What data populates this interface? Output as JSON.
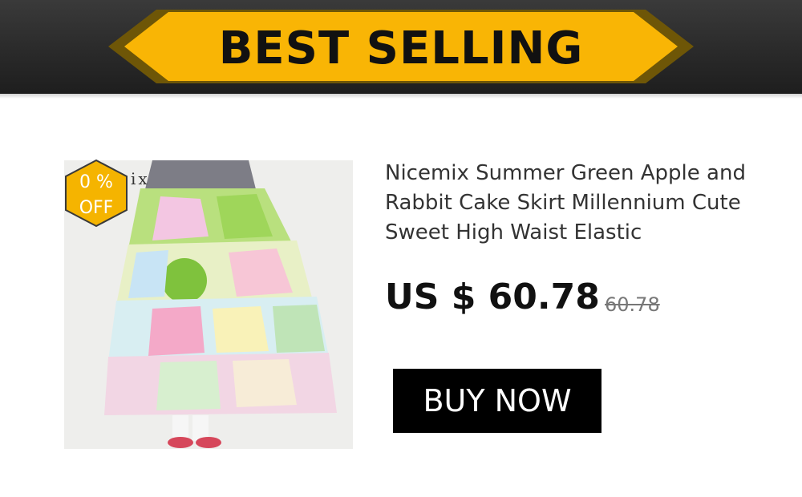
{
  "banner": {
    "title": "BEST SELLING"
  },
  "badge": {
    "line1": "0  %",
    "line2": "OFF"
  },
  "image": {
    "watermark": "ix"
  },
  "product": {
    "title": "Nicemix Summer Green Apple and Rabbit Cake Skirt Millennium Cute Sweet High Waist Elastic",
    "price": "US $ 60.78",
    "original_price": "60.78"
  },
  "cta": {
    "label": "BUY NOW"
  },
  "colors": {
    "banner_yellow": "#f9b505",
    "banner_dark": "#2b2b2b",
    "badge_fill": "#f5b400",
    "button_bg": "#000000"
  }
}
